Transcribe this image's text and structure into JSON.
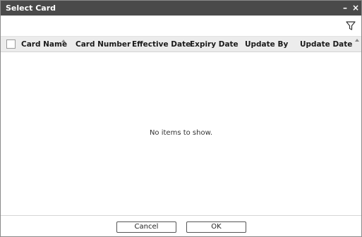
{
  "window": {
    "title": "Select Card",
    "minimize_glyph": "–",
    "close_glyph": "×"
  },
  "toolbar": {
    "filter_icon": "filter-icon"
  },
  "grid": {
    "columns": [
      {
        "label": "Card Name",
        "sorted": "ascending"
      },
      {
        "label": "Card Number"
      },
      {
        "label": "Effective Date"
      },
      {
        "label": "Expiry Date"
      },
      {
        "label": "Update By"
      },
      {
        "label": "Update Date"
      }
    ],
    "empty_message": "No items to show."
  },
  "footer": {
    "cancel_label": "Cancel",
    "ok_label": "OK"
  },
  "colors": {
    "titlebar": "#4a4a4a",
    "header_bg": "#ececec"
  }
}
